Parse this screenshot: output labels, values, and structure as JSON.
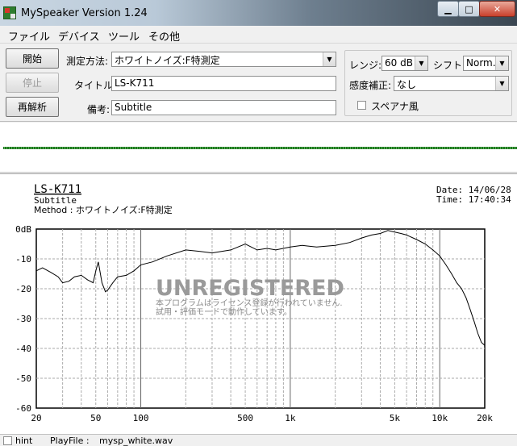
{
  "window": {
    "title": "MySpeaker Version 1.24"
  },
  "menu": [
    "ファイル",
    "デバイス",
    "ツール",
    "その他"
  ],
  "buttons": {
    "start": "開始",
    "stop": "停止",
    "reanalyze": "再解析"
  },
  "form": {
    "method_label": "測定方法:",
    "method_value": "ホワイトノイズ:F特測定",
    "title_label": "タイトル:",
    "title_value": "LS-K711",
    "note_label": "備考:",
    "note_value": "Subtitle"
  },
  "settings": {
    "range_label": "レンジ:",
    "range_value": "60 dB",
    "shift_label": "シフト:",
    "shift_value": "Norm.",
    "sensitivity_label": "感度補正:",
    "sensitivity_value": "なし",
    "spana_label": "スペアナ風",
    "spana_checked": false
  },
  "graph": {
    "title": "LS-K711",
    "subtitle": "Subtitle",
    "method": "Method :  ホワイトノイズ:F特測定",
    "date": "Date: 14/06/28",
    "time": "Time: 17:40:34",
    "watermark": "UNREGISTERED",
    "notice1": "本プログラムはライセンス登録が行われていません.",
    "notice2": "試用・評価モードで動作しています。"
  },
  "chart_data": {
    "type": "line",
    "xscale": "log",
    "xlim": [
      20,
      20000
    ],
    "ylim": [
      -60,
      0
    ],
    "x_ticks": [
      "20",
      "50",
      "100",
      "500",
      "1k",
      "5k",
      "10k",
      "20k"
    ],
    "y_ticks": [
      "0dB",
      "-10",
      "-20",
      "-30",
      "-40",
      "-50",
      "-60"
    ],
    "grid": true,
    "series": [
      {
        "x": [
          20,
          22,
          25,
          28,
          30,
          33,
          36,
          40,
          44,
          48,
          50,
          52,
          55,
          58,
          60,
          65,
          70,
          80,
          90,
          100,
          120,
          150,
          200,
          250,
          300,
          400,
          500,
          600,
          700,
          800,
          1000,
          1200,
          1500,
          2000,
          2500,
          3000,
          3500,
          4000,
          4500,
          5000,
          5500,
          6000,
          7000,
          8000,
          9000,
          10000,
          11000,
          12000,
          13000,
          14000,
          15000,
          16000,
          17000,
          18000,
          19000,
          20000
        ],
        "y": [
          -14,
          -13,
          -14.5,
          -16,
          -18,
          -17.5,
          -16,
          -15.5,
          -17,
          -18,
          -14,
          -11,
          -18,
          -21,
          -20.5,
          -18,
          -16,
          -15.5,
          -14,
          -12,
          -11,
          -9,
          -7,
          -7.5,
          -8,
          -7,
          -5,
          -7,
          -6.5,
          -7,
          -6,
          -5.5,
          -6,
          -5.5,
          -4.5,
          -3,
          -2,
          -1.5,
          -0.5,
          -1,
          -1.5,
          -2,
          -3.5,
          -5,
          -7,
          -9,
          -12,
          -15,
          -18,
          -20,
          -23,
          -27,
          -31,
          -35,
          -38,
          -39
        ]
      }
    ]
  },
  "status": {
    "hint": "hint",
    "play_label": "PlayFile  :",
    "play_file": "mysp_white.wav"
  }
}
